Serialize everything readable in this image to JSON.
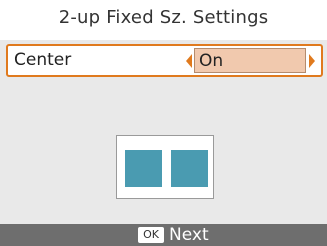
{
  "header": {
    "title": "2-up Fixed Sz. Settings"
  },
  "setting": {
    "label": "Center",
    "value": "On"
  },
  "footer": {
    "ok_label": "OK",
    "next_label": "Next"
  },
  "colors": {
    "accent": "#e07a1e",
    "value_bg": "#f1c9ae",
    "photo": "#4a9bb1",
    "footer_bg": "#6e6e6e"
  }
}
